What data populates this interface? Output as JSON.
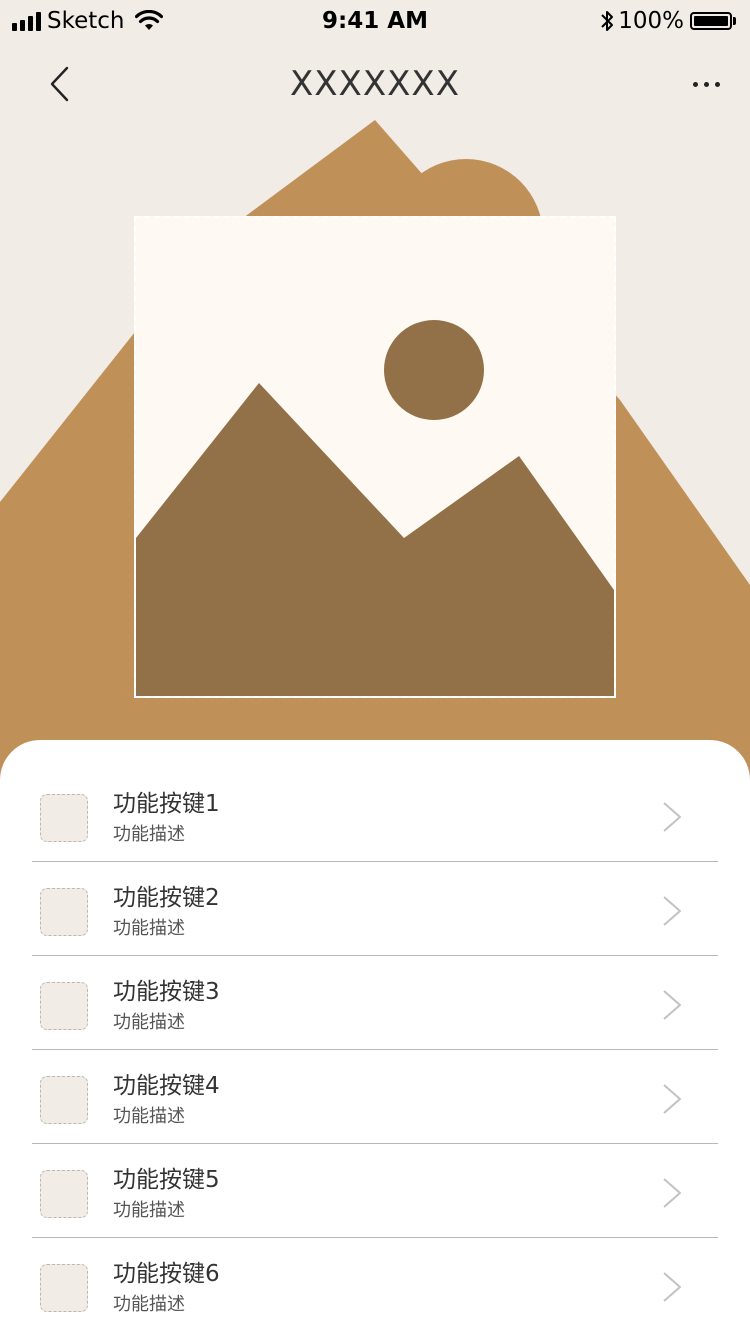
{
  "status_bar": {
    "carrier": "Sketch",
    "time": "9:41 AM",
    "battery": "100%",
    "icons": [
      "signal-icon",
      "wifi-icon",
      "bluetooth-icon",
      "battery-icon"
    ]
  },
  "nav": {
    "title": "XXXXXXX",
    "icons": [
      "back-icon",
      "more-icon"
    ]
  },
  "hero": {
    "image_icon": "image-placeholder-icon"
  },
  "menu": {
    "items": [
      {
        "title": "功能按键1",
        "desc": "功能描述"
      },
      {
        "title": "功能按键2",
        "desc": "功能描述"
      },
      {
        "title": "功能按键3",
        "desc": "功能描述"
      },
      {
        "title": "功能按键4",
        "desc": "功能描述"
      },
      {
        "title": "功能按键5",
        "desc": "功能描述"
      },
      {
        "title": "功能按键6",
        "desc": "功能描述"
      }
    ]
  },
  "colors": {
    "background": "#f1ece5",
    "accent": "#c09059",
    "accent_dark": "#927048",
    "image_bg": "#fef9f3",
    "sheet": "#ffffff"
  }
}
